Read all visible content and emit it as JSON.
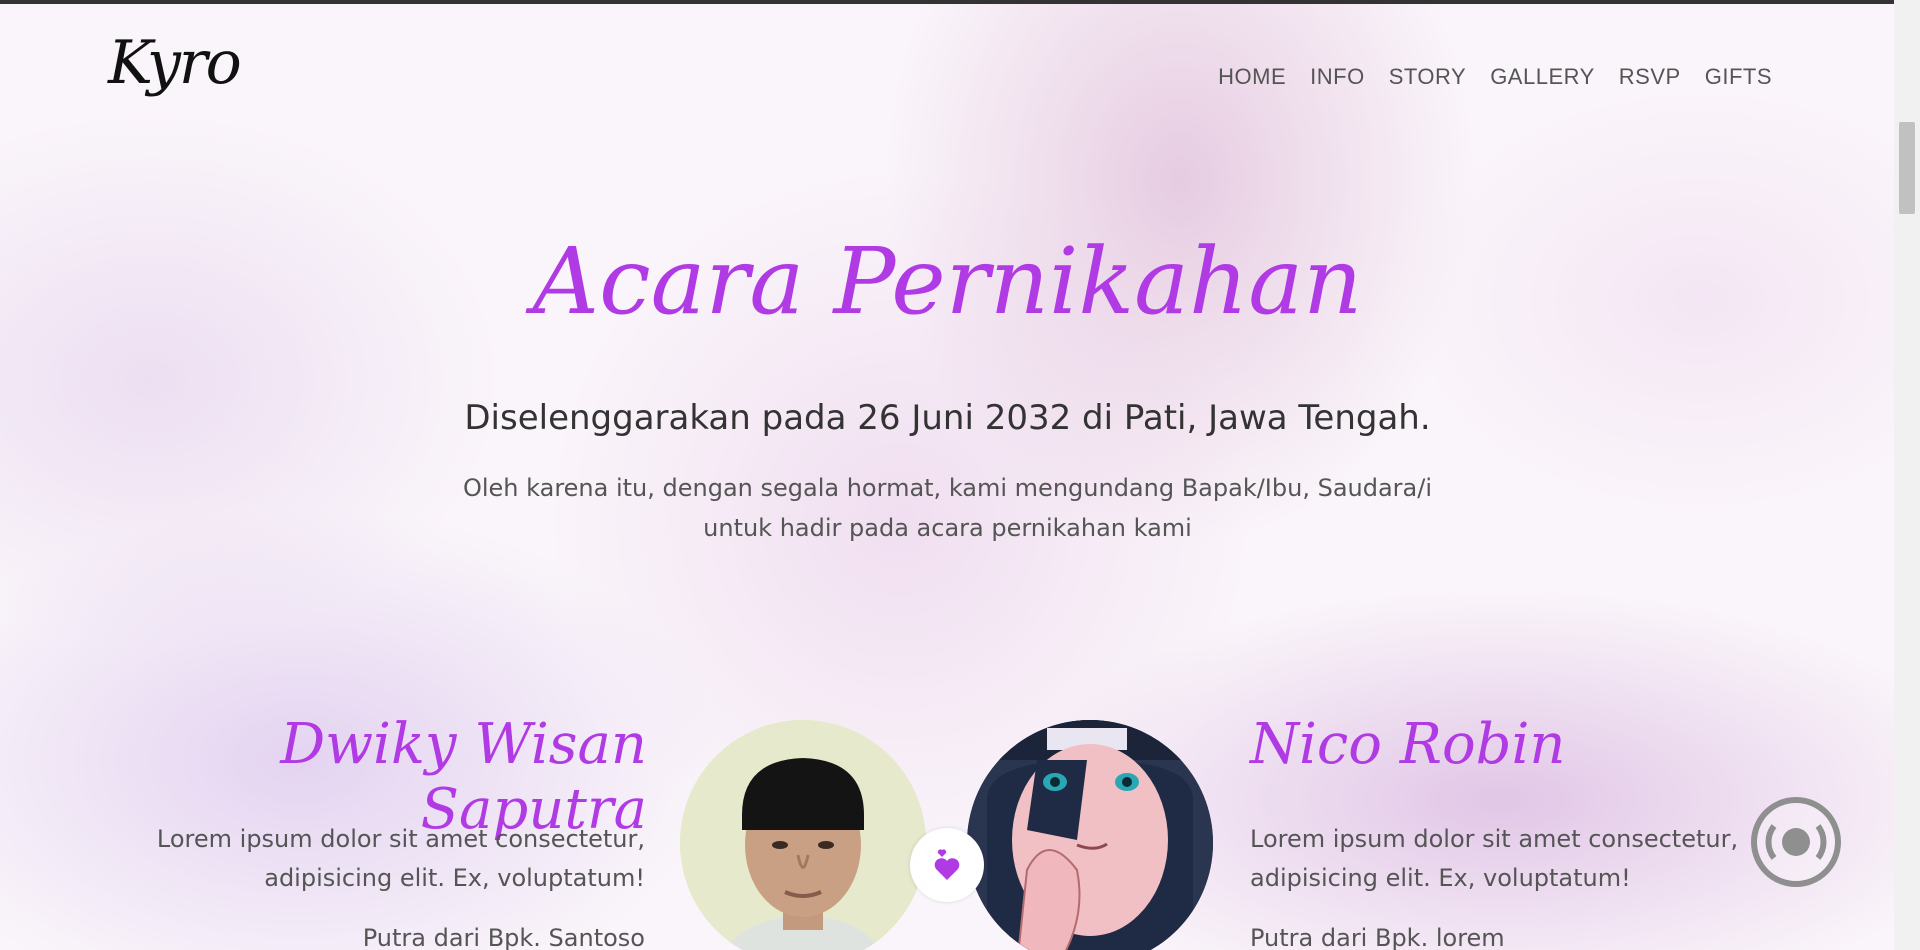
{
  "brand": {
    "logo": "Kyro"
  },
  "nav": {
    "items": [
      {
        "label": "HOME"
      },
      {
        "label": "INFO"
      },
      {
        "label": "STORY"
      },
      {
        "label": "GALLERY"
      },
      {
        "label": "RSVP"
      },
      {
        "label": "GIFTS"
      }
    ]
  },
  "hero": {
    "title": "Acara Pernikahan",
    "subtitle": "Diselenggarakan pada 26 Juni 2032 di Pati, Jawa Tengah.",
    "text_line1": "Oleh karena itu, dengan segala hormat, kami mengundang Bapak/Ibu, Saudara/i",
    "text_line2": "untuk hadir pada acara pernikahan kami"
  },
  "groom": {
    "name": "Dwiky Wisan Saputra",
    "desc_line1": "Lorem ipsum dolor sit amet consectetur,",
    "desc_line2": "adipisicing elit. Ex, voluptatum!",
    "parents": "Putra dari Bpk. Santoso"
  },
  "bride": {
    "name": "Nico Robin",
    "desc_line1": "Lorem ipsum dolor sit amet consectetur,",
    "desc_line2": "adipisicing elit. Ex, voluptatum!",
    "parents": "Putra dari Bpk. lorem"
  },
  "colors": {
    "accent": "#b03ae4",
    "heart": "#b03ae4",
    "text": "#555555"
  },
  "icons": {
    "heart_badge": "hearts-icon",
    "audio": "audio-disc-icon"
  }
}
